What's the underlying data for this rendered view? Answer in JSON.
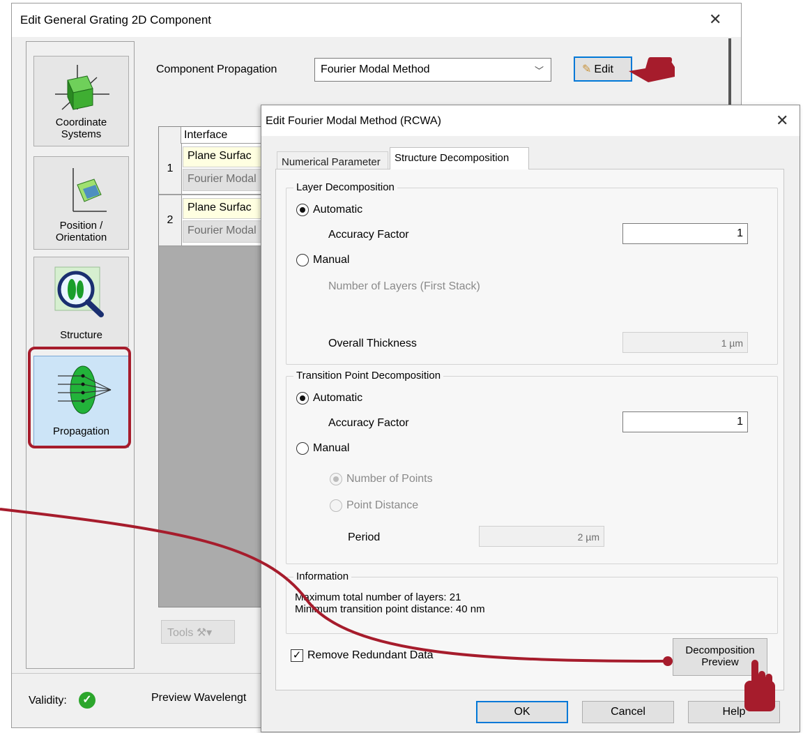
{
  "outer_window": {
    "title": "Edit General Grating 2D Component",
    "nav": {
      "coordinate_systems": "Coordinate Systems",
      "position_orientation": "Position / Orientation",
      "structure": "Structure",
      "propagation": "Propagation"
    },
    "component_propagation_label": "Component Propagation",
    "component_propagation_value": "Fourier Modal Method",
    "edit_button": "Edit",
    "table": {
      "header": "Interface",
      "rows": [
        {
          "index": "1",
          "surface": "Plane Surfac",
          "method": "Fourier Modal"
        },
        {
          "index": "2",
          "surface": "Plane Surfac",
          "method": "Fourier Modal"
        }
      ]
    },
    "tools_button": "Tools",
    "validity_label": "Validity:",
    "preview_wavelength_label": "Preview Wavelengt"
  },
  "inner_dialog": {
    "title": "Edit Fourier Modal Method (RCWA)",
    "tabs": [
      {
        "label": "Numerical Parameter",
        "active": false
      },
      {
        "label": "Structure Decomposition",
        "active": true
      }
    ],
    "layer_decomposition": {
      "title": "Layer Decomposition",
      "automatic": "Automatic",
      "accuracy_factor_label": "Accuracy Factor",
      "accuracy_factor_value": "1",
      "manual": "Manual",
      "number_of_layers_label": "Number of Layers (First Stack)",
      "overall_thickness_label": "Overall Thickness",
      "overall_thickness_value": "1 µm"
    },
    "transition_point_decomposition": {
      "title": "Transition Point Decomposition",
      "automatic": "Automatic",
      "accuracy_factor_label": "Accuracy Factor",
      "accuracy_factor_value": "1",
      "manual": "Manual",
      "number_of_points": "Number of Points",
      "point_distance": "Point Distance",
      "period_label": "Period",
      "period_value": "2 µm"
    },
    "information": {
      "title": "Information",
      "line1": "Maximum total number of layers: 21",
      "line2": "Minimum transition point distance: 40 nm"
    },
    "remove_redundant_data": "Remove Redundant Data",
    "remove_redundant_checked": true,
    "decomposition_preview_line1": "Decomposition",
    "decomposition_preview_line2": "Preview",
    "ok": "OK",
    "cancel": "Cancel",
    "help": "Help"
  },
  "colors": {
    "annotation": "#a61c2c",
    "accent": "#0078d7",
    "valid": "#2ca62c"
  }
}
